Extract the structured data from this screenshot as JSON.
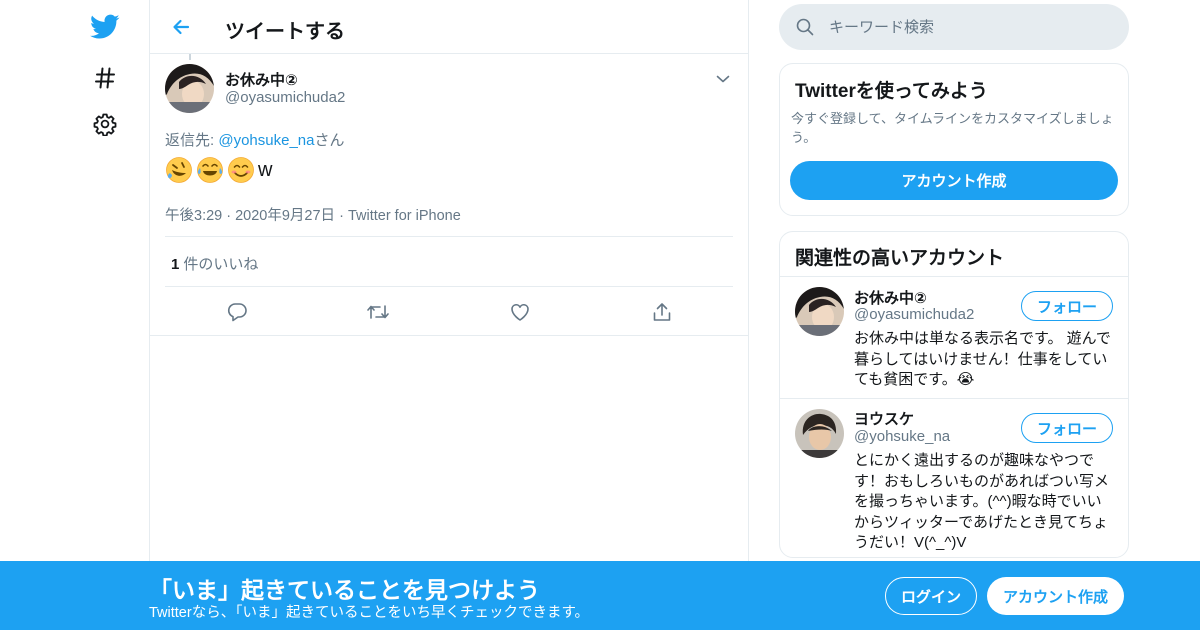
{
  "colors": {
    "brand": "#1da1f2",
    "link": "#1b95e0",
    "text_primary": "#14171a",
    "text_secondary": "#657786",
    "border": "#e6ecf0"
  },
  "nav": {
    "items": [
      {
        "icon": "twitter-bird-icon"
      },
      {
        "icon": "hashtag-icon"
      },
      {
        "icon": "gear-icon"
      }
    ]
  },
  "header": {
    "back_icon": "arrow-left-icon",
    "title": "ツイートする"
  },
  "tweet": {
    "author_name": "お休み中②",
    "author_handle": "@oyasumichuda2",
    "reply_prefix": "返信先:",
    "reply_handle": "@yohsuke_na",
    "reply_suffix": "さん",
    "emojis": [
      "rolling-on-floor-laughing-emoji",
      "tears-of-joy-emoji",
      "smiling-face-emoji"
    ],
    "text_suffix": "w",
    "meta": "午後3:29 · 2020年9月27日 · Twitter for iPhone",
    "like_count": "1",
    "like_label": "件のいいね",
    "actions": [
      "reply-icon",
      "retweet-icon",
      "like-icon",
      "share-icon"
    ]
  },
  "search": {
    "placeholder": "キーワード検索"
  },
  "signup_card": {
    "title": "Twitterを使ってみよう",
    "description": "今すぐ登録して、タイムラインをカスタマイズしましょう。",
    "button": "アカウント作成"
  },
  "related_card": {
    "title": "関連性の高いアカウント",
    "users": [
      {
        "name": "お休み中②",
        "handle": "@oyasumichuda2",
        "bio": "お休み中は単なる表示名です。 遊んで暮らしてはいけません！仕事をしていても貧困です。😭",
        "follow": "フォロー"
      },
      {
        "name": "ヨウスケ",
        "handle": "@yohsuke_na",
        "bio": "とにかく遠出するのが趣味なやつです！おもしろいものがあればつい写メを撮っちゃいます。(^^)暇な時でいいからツィッターであげたとき見てちょうだい！V(^_^)V",
        "follow": "フォロー"
      }
    ]
  },
  "banner": {
    "title": "「いま」起きていることを見つけよう",
    "subtitle": "Twitterなら、「いま」起きていることをいち早くチェックできます。",
    "login": "ログイン",
    "signup": "アカウント作成"
  }
}
